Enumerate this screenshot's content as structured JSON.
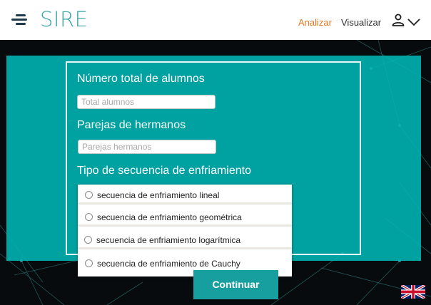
{
  "header": {
    "logo": "SIRE",
    "nav": [
      {
        "label": "Analizar",
        "color": "#e87722"
      },
      {
        "label": "Visualizar",
        "color": "#333333"
      }
    ],
    "icons": {
      "menu": "hamburger-icon",
      "user": "user-icon",
      "dropdown": "chevron-down-icon"
    }
  },
  "form": {
    "total_label": "Número total de alumnos",
    "total_placeholder": "Total alumnos",
    "parejas_label": "Parejas de hermanos",
    "parejas_placeholder": "Parejas hermanos",
    "tipo_label": "Tipo de secuencia de enfriamiento",
    "options": [
      "secuencia de enfriamiento lineal",
      "secuencia de enfriamiento geométrica",
      "secuencia de enfriamiento logarítmica",
      "secuencia de enfriamiento de Cauchy"
    ],
    "submit_label": "Continuar"
  },
  "language_flag": "uk-flag-icon",
  "colors": {
    "brand_teal": "#3aa6a6",
    "panel_teal": "#00b6b6",
    "button_teal": "#179e9e",
    "accent_orange": "#e87722"
  }
}
